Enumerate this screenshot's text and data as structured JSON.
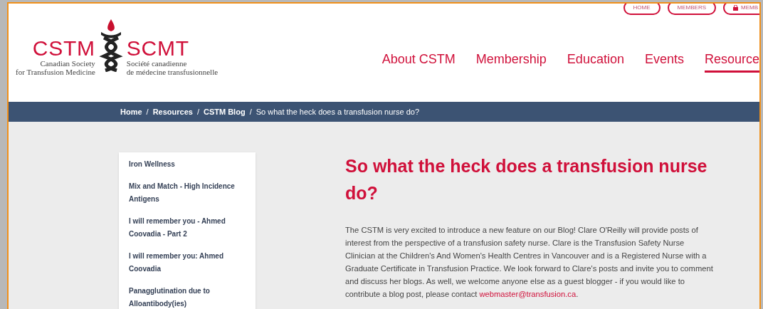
{
  "logo": {
    "acronym_en": "CSTM",
    "acronym_fr": "SCMT",
    "name_en": [
      "Canadian Society",
      "for Transfusion Medicine"
    ],
    "name_fr": [
      "Société canadienne",
      "de médecine transfusionnelle"
    ]
  },
  "top_links": [
    {
      "label": "HOME",
      "kind": "plain"
    },
    {
      "label": "MEMBERS",
      "kind": "plain"
    },
    {
      "label": "MEMB",
      "kind": "locked"
    }
  ],
  "nav": [
    {
      "label": "About CSTM",
      "selected": false
    },
    {
      "label": "Membership",
      "selected": false
    },
    {
      "label": "Education",
      "selected": false
    },
    {
      "label": "Events",
      "selected": false
    },
    {
      "label": "Resource",
      "selected": true
    }
  ],
  "breadcrumb": {
    "separator": "/",
    "links": [
      "Home",
      "Resources",
      "CSTM Blog"
    ],
    "current": "So what the heck does a transfusion nurse do?"
  },
  "sidebar": {
    "items": [
      "Iron Wellness",
      "Mix and Match - High Incidence Antigens",
      "I will remember you - Ahmed Coovadia - Part 2",
      "I will remember you: Ahmed Coovadia",
      "Panagglutination due to Alloantibody(ies)"
    ]
  },
  "article": {
    "title": "So what the heck does a transfusion nurse do?",
    "paragraph": {
      "text": "The CSTM is very excited to introduce a new feature on our Blog! Clare O'Reilly will provide posts of interest from the perspective of a transfusion safety nurse. Clare is the Transfusion Safety Nurse Clinician at the Children's And Women's Health Centres in Vancouver and is a Registered Nurse with a Graduate Certificate in Transfusion Practice. We look forward to Clare's posts and invite you to comment and discuss her blogs. As well, we welcome anyone else as a guest blogger - if you would like to contribute a blog post, please contact ",
      "link": "webmaster@transfusion.ca",
      "after": "."
    }
  }
}
